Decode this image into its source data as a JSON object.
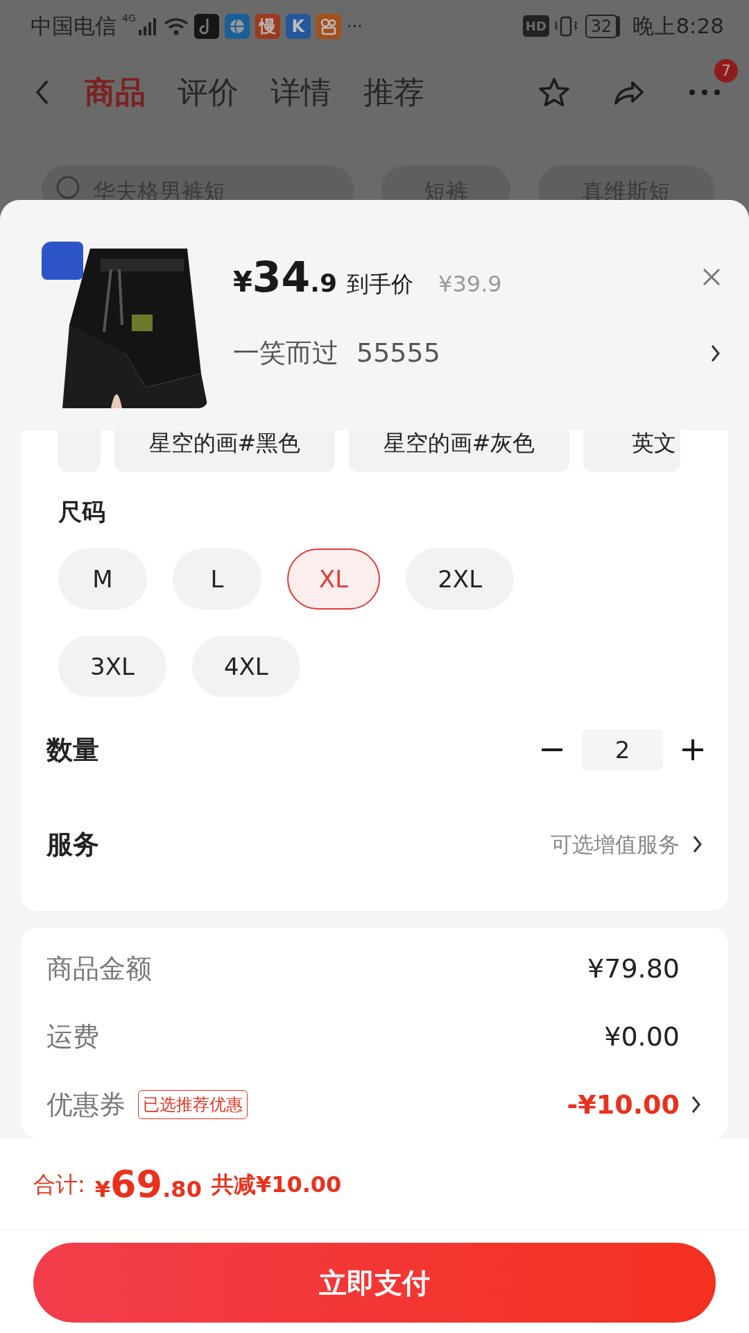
{
  "status_bar": {
    "carrier": "中国电信",
    "network": "4G",
    "app_icons": [
      {
        "kind": "note",
        "color": "#161616"
      },
      {
        "kind": "globe",
        "color": "#1b5f98"
      },
      {
        "kind": "glyph",
        "color": "#9c3a1d",
        "glyph": "慢"
      },
      {
        "kind": "glyph",
        "color": "#24589a",
        "glyph": "K"
      },
      {
        "kind": "camera",
        "color": "#a4501b"
      }
    ],
    "more": "···",
    "hd": "HD",
    "battery": "32",
    "time": "晚上8:28"
  },
  "nav": {
    "tabs": [
      {
        "label": "商品",
        "selected": true
      },
      {
        "label": "评价",
        "selected": false
      },
      {
        "label": "详情",
        "selected": false
      },
      {
        "label": "推荐",
        "selected": false
      }
    ],
    "badge": "7"
  },
  "background": {
    "search": {
      "placeholder": "华夫格男裤短"
    },
    "chips": [
      "短裤",
      "真维斯短"
    ]
  },
  "product": {
    "kind": "picture",
    "currency": "¥",
    "price_int": "34",
    "price_dec": ".9",
    "price_label": "到手价",
    "original_price": "¥39.9",
    "seller": "一笑而过",
    "seller_code": "55555"
  },
  "colors": [
    {
      "selected": false
    },
    {
      "label": "星空的画#黑色",
      "selected": false
    },
    {
      "label": "星空的画#灰色",
      "selected": false
    },
    {
      "label": "英文",
      "selected": false
    }
  ],
  "size_section": {
    "title": "尺码",
    "sizes": [
      {
        "label": "M",
        "selected": false
      },
      {
        "label": "L",
        "selected": false
      },
      {
        "label": "XL",
        "selected": true
      },
      {
        "label": "2XL",
        "selected": false
      },
      {
        "label": "3XL",
        "selected": false
      },
      {
        "label": "4XL",
        "selected": false
      }
    ]
  },
  "quantity": {
    "label": "数量",
    "value": "2"
  },
  "service": {
    "label": "服务",
    "value": "可选增值服务"
  },
  "summary": [
    {
      "kind": "plain",
      "label": "商品金额",
      "value": "¥79.80"
    },
    {
      "kind": "plain",
      "label": "运费",
      "value": "¥0.00"
    },
    {
      "kind": "discount",
      "label": "优惠券",
      "tag": "已选推荐优惠",
      "value": "-¥10.00"
    }
  ],
  "total": {
    "label": "合计:",
    "currency": "¥",
    "int": "69",
    "dec": ".80",
    "saved": "共减¥10.00"
  },
  "pay_button": "立即支付"
}
